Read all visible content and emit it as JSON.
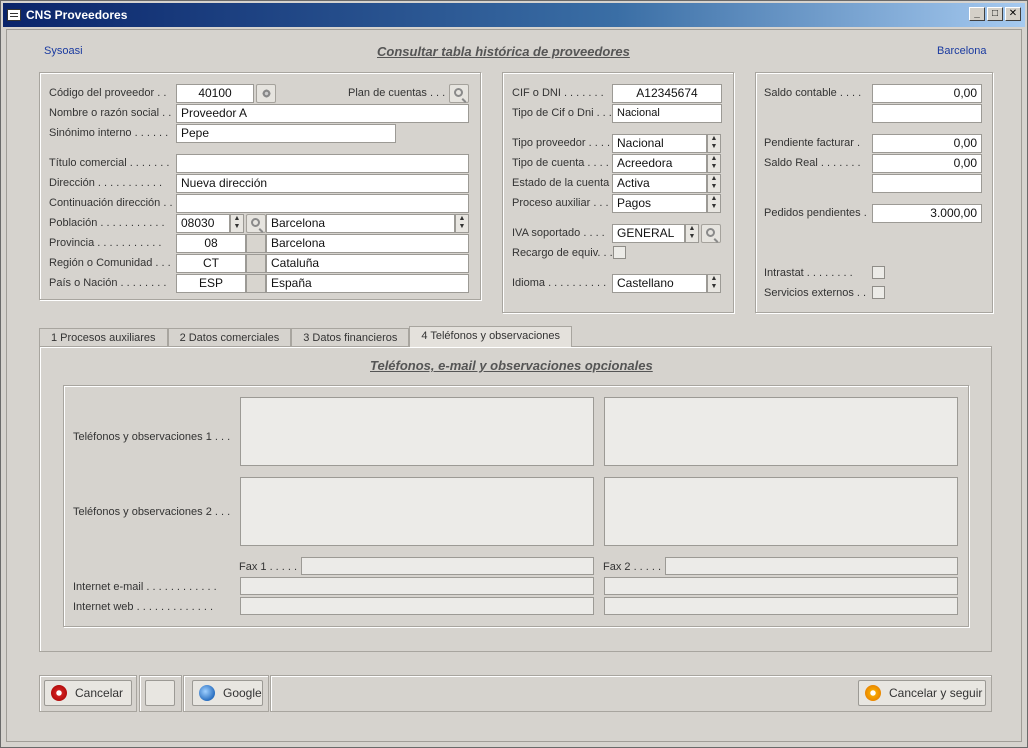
{
  "window": {
    "title": "CNS Proveedores",
    "minimize": "_",
    "maximize": "□",
    "close": "✕"
  },
  "header": {
    "company": "Sysoasi",
    "title": "Consultar tabla histórica de proveedores",
    "city": "Barcelona"
  },
  "supplier": {
    "code_label": "Código del proveedor . .",
    "code": "40100",
    "accounts_plan_label": "Plan de cuentas . . .",
    "name_label": "Nombre o razón social . .",
    "name": "Proveedor A",
    "synonym_label": "Sinónimo interno . . . . . .",
    "synonym": "Pepe",
    "trade_title_label": "Título comercial . . . . . . .",
    "trade_title": "",
    "address_label": "Dirección . . . . . . . . . . .",
    "address": "Nueva dirección",
    "address2_label": "Continuación dirección . .",
    "address2": "",
    "town_label": "Población . . . . . . . . . . .",
    "town_code": "08030",
    "town": "Barcelona",
    "province_label": "Provincia . . . . . . . . . . .",
    "province_code": "08",
    "province": "Barcelona",
    "region_label": "Región o Comunidad . . .",
    "region_code": "CT",
    "region": "Cataluña",
    "country_label": "País o Nación . . . . . . . .",
    "country_code": "ESP",
    "country": "España"
  },
  "tax": {
    "cif_label": "CIF o DNI . . . . . . .",
    "cif": "A12345674",
    "cif_type_label": "Tipo de Cif o Dni . . .",
    "cif_type": "Nacional",
    "supplier_type_label": "Tipo proveedor . . . .",
    "supplier_type": "Nacional",
    "account_type_label": "Tipo de cuenta . . . .",
    "account_type": "Acreedora",
    "account_status_label": "Estado de la cuenta . .",
    "account_status": "Activa",
    "aux_process_label": "Proceso auxiliar . . .",
    "aux_process": "Pagos",
    "vat_label": "IVA soportado . . . .",
    "vat": "GENERAL",
    "surcharge_label": "Recargo de equiv. . .",
    "language_label": "Idioma . . . . . . . . . .",
    "language": "Castellano"
  },
  "balances": {
    "accounting_balance_label": "Saldo contable . . . .",
    "accounting_balance": "0,00",
    "pending_invoice_label": "Pendiente facturar .",
    "pending_invoice": "0,00",
    "real_balance_label": "Saldo Real . . . . . . .",
    "real_balance": "0,00",
    "pending_orders_label": "Pedidos pendientes .",
    "pending_orders": "3.000,00",
    "intrastat_label": "Intrastat . . . . . . . .",
    "external_services_label": "Servicios externos . ."
  },
  "tabs": [
    {
      "label": "1 Procesos auxiliares"
    },
    {
      "label": "2 Datos comerciales"
    },
    {
      "label": "3 Datos financieros"
    },
    {
      "label": "4 Teléfonos y observaciones"
    }
  ],
  "phones": {
    "title": "Teléfonos, e-mail y observaciones opcionales",
    "obs1_label": "Teléfonos y observaciones 1 . . .",
    "obs2_label": "Teléfonos y observaciones 2 . . .",
    "fax1_label": "Fax 1 . . . . .",
    "fax2_label": "Fax 2 . . . . .",
    "email_label": "Internet e-mail . . . . . . . . . . . .",
    "web_label": "Internet web . . . . . . . . . . . . ."
  },
  "buttons": {
    "cancel": "Cancelar",
    "google": "Google",
    "cancel_continue": "Cancelar y seguir"
  }
}
